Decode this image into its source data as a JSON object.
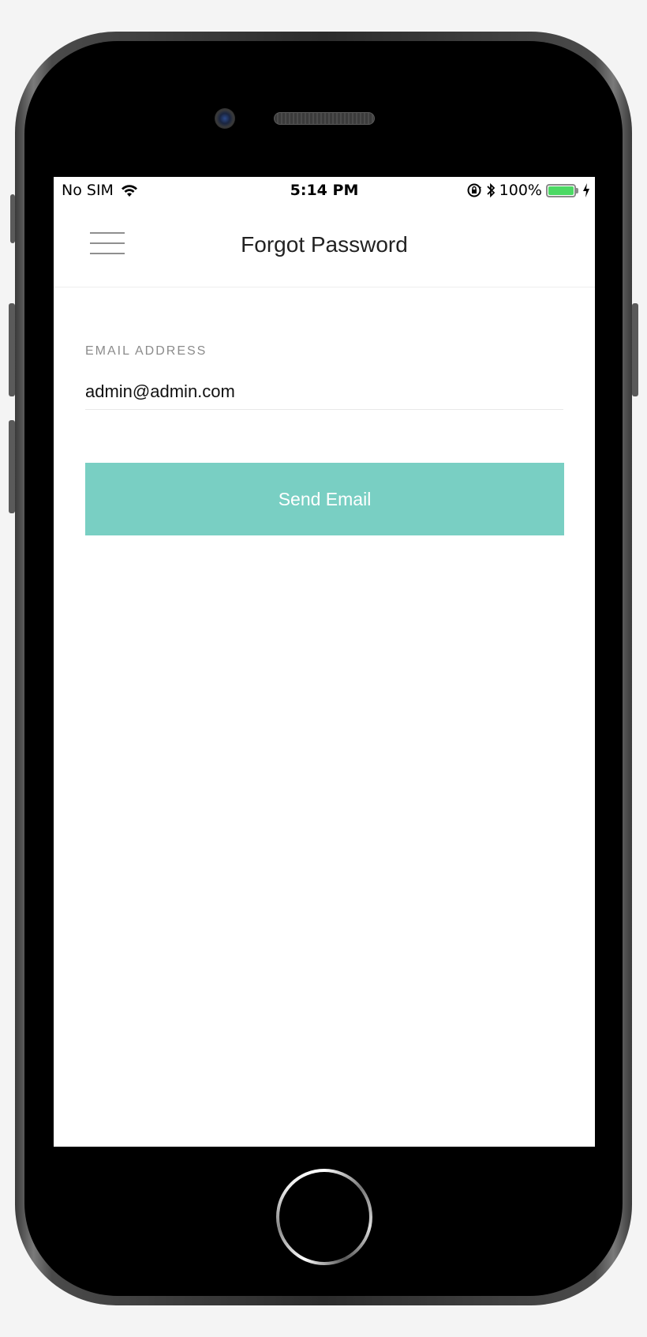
{
  "status_bar": {
    "carrier": "No SIM",
    "time": "5:14 PM",
    "battery_percent": "100%",
    "battery_level": 1.0,
    "icons": [
      "wifi-icon",
      "orientation-lock-icon",
      "bluetooth-icon",
      "battery-icon",
      "charging-bolt-icon"
    ]
  },
  "nav": {
    "title": "Forgot Password",
    "menu_icon": "hamburger-menu-icon"
  },
  "form": {
    "email_label": "EMAIL ADDRESS",
    "email_value": "admin@admin.com",
    "submit_label": "Send Email"
  },
  "colors": {
    "accent": "#79cfc3",
    "battery": "#4cd964"
  }
}
